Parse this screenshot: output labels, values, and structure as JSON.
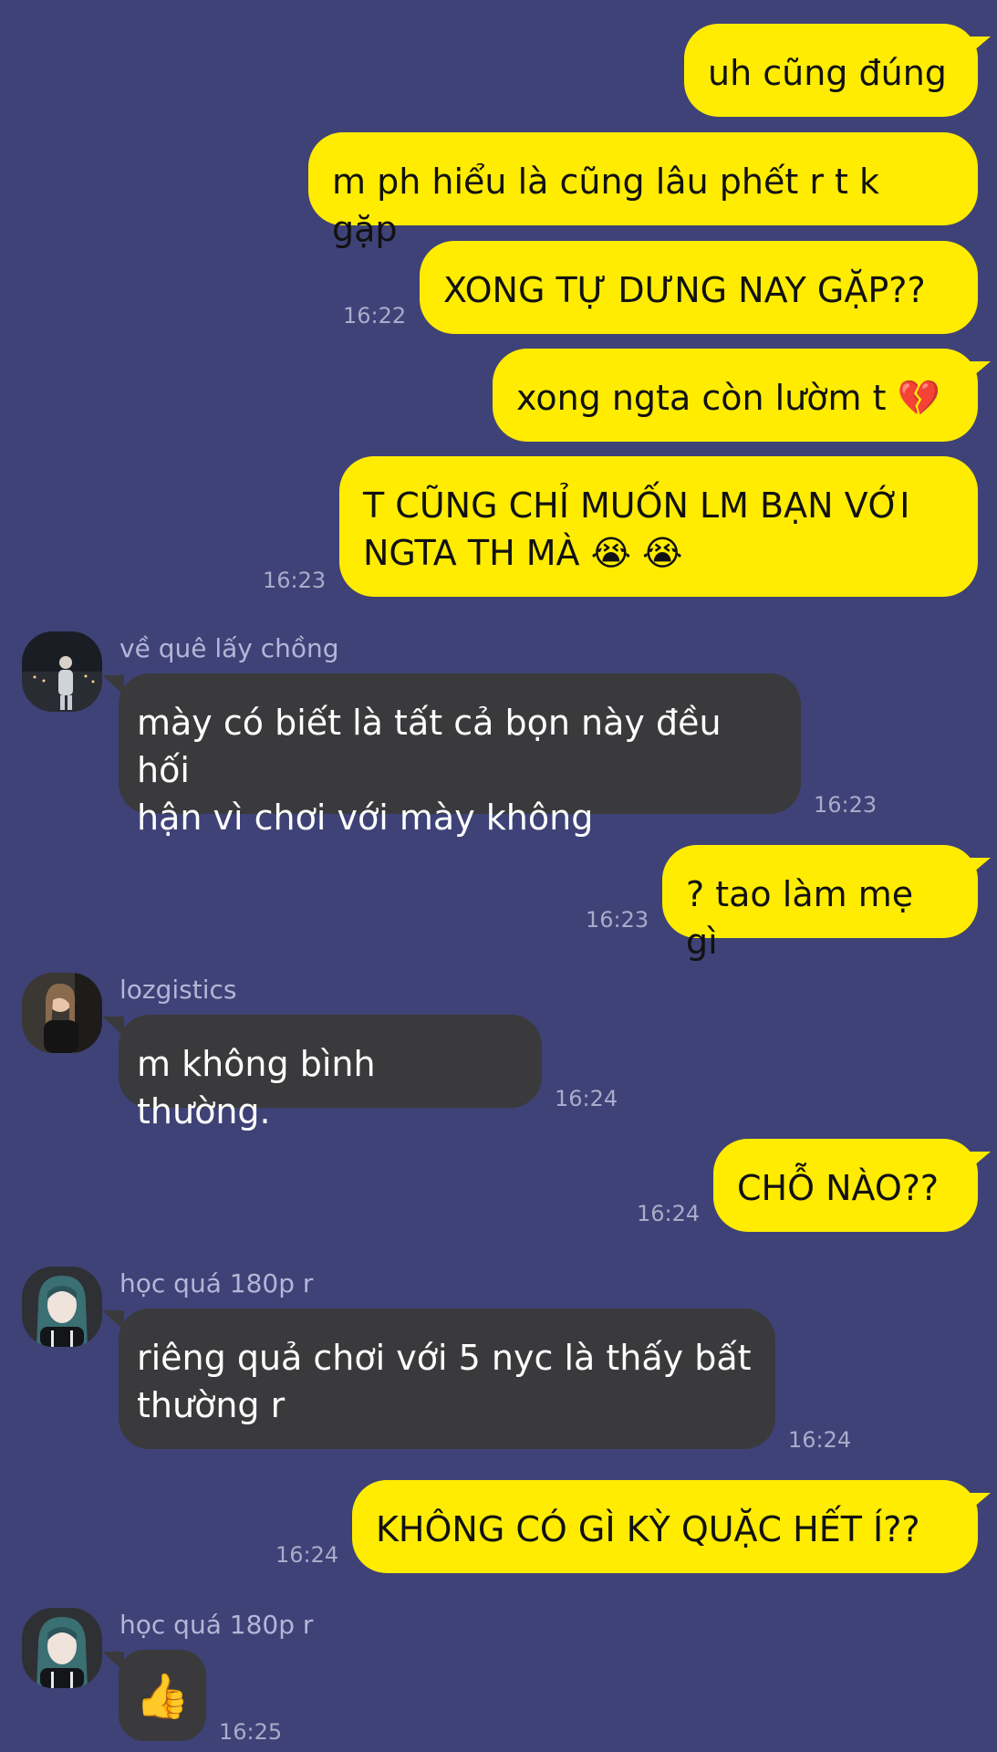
{
  "chat": {
    "messages": [
      {
        "text": "uh cũng đúng",
        "time": ""
      },
      {
        "text": "m ph hiểu là cũng lâu phết r t k gặp",
        "time": ""
      },
      {
        "text": "XONG TỰ DƯNG NAY GẶP??",
        "time": "16:22"
      },
      {
        "text": "xong ngta còn lườm t 💔",
        "time": ""
      },
      {
        "text": "T CŨNG CHỈ MUỐN LM BẠN VỚI\nNGTA TH MÀ 😭 😭",
        "time": "16:23"
      },
      {
        "sender": "về quê lấy chồng",
        "text": "mày có biết là tất cả bọn này đều hối\nhận vì chơi với mày không",
        "time": "16:23"
      },
      {
        "text": "? tao làm mẹ gì",
        "time": "16:23"
      },
      {
        "sender": "lozgistics",
        "text": "m không bình thường.",
        "time": "16:24"
      },
      {
        "text": "CHỖ NÀO??",
        "time": "16:24"
      },
      {
        "sender": "học quá 180p r",
        "text": "riêng quả chơi với 5 nyc là thấy bất\nthường r",
        "time": "16:24"
      },
      {
        "text": "KHÔNG CÓ GÌ KỲ QUẶC HẾT Í??",
        "time": "16:24"
      },
      {
        "sender": "học quá 180p r",
        "text": "👍",
        "time": "16:25"
      }
    ]
  },
  "colors": {
    "background": "#3f4277",
    "outgoing_bubble": "#ffec00",
    "incoming_bubble": "#3a3a3c",
    "timestamp": "#a9abc9"
  },
  "icons": {
    "avatar_1": "avatar-night-city",
    "avatar_2": "avatar-portrait",
    "avatar_3": "avatar-portrait-dark",
    "thumbs_up": "thumbs-up-emoji"
  }
}
